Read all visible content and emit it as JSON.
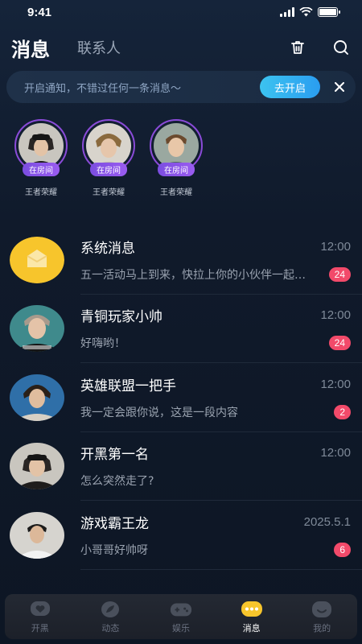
{
  "status_bar": {
    "time": "9:41"
  },
  "header": {
    "tab_active": "消息",
    "tab_inactive": "联系人"
  },
  "notify": {
    "text": "开启通知，不错过任何一条消息～",
    "button": "去开启"
  },
  "stories": [
    {
      "badge": "在房间",
      "name": "王者荣耀"
    },
    {
      "badge": "在房间",
      "name": "王者荣耀"
    },
    {
      "badge": "在房间",
      "name": "王者荣耀"
    }
  ],
  "conversations": [
    {
      "name": "系统消息",
      "time": "12:00",
      "message": "五一活动马上到来，快拉上你的小伙伴一起参加吧",
      "badge": "24"
    },
    {
      "name": "青铜玩家小帅",
      "time": "12:00",
      "message": "好嗨哟！",
      "badge": "24"
    },
    {
      "name": "英雄联盟一把手",
      "time": "12:00",
      "message": "我一定会跟你说，这是一段内容",
      "badge": "2"
    },
    {
      "name": "开黑第一名",
      "time": "12:00",
      "message": "怎么突然走了?",
      "badge": ""
    },
    {
      "name": "游戏霸王龙",
      "time": "2025.5.1",
      "message": "小哥哥好帅呀",
      "badge": "6"
    }
  ],
  "tabbar": [
    {
      "label": "开黑",
      "icon": "heart-chat-icon"
    },
    {
      "label": "动态",
      "icon": "leaf-icon"
    },
    {
      "label": "娱乐",
      "icon": "gamepad-icon"
    },
    {
      "label": "消息",
      "icon": "message-dots-icon",
      "active": true
    },
    {
      "label": "我的",
      "icon": "smile-face-icon"
    }
  ],
  "colors": {
    "accent": "#f7c52c",
    "badge": "#f24a6a",
    "ring": "#8a4bd8",
    "button": "#2a9df0"
  }
}
